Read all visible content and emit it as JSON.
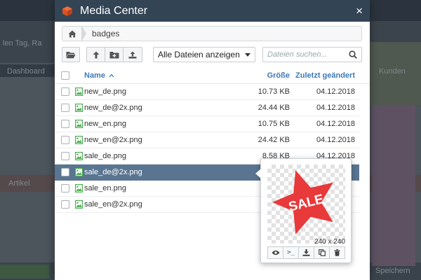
{
  "background": {
    "texts": [
      "len Tag, Ra",
      "Dashboard",
      "Artikel",
      "Kunden",
      "Speichern"
    ]
  },
  "modal": {
    "title": "Media Center",
    "close_label": "×"
  },
  "breadcrumb": {
    "current": "badges"
  },
  "toolbar": {
    "filter_selected": "Alle Dateien anzeigen",
    "search_placeholder": "Dateien suchen..."
  },
  "table": {
    "headers": {
      "name": "Name",
      "size": "Größe",
      "modified": "Zuletzt geändert"
    },
    "rows": [
      {
        "name": "new_de.png",
        "size": "10.73 KB",
        "date": "04.12.2018"
      },
      {
        "name": "new_de@2x.png",
        "size": "24.44 KB",
        "date": "04.12.2018"
      },
      {
        "name": "new_en.png",
        "size": "10.75 KB",
        "date": "04.12.2018"
      },
      {
        "name": "new_en@2x.png",
        "size": "24.42 KB",
        "date": "04.12.2018"
      },
      {
        "name": "sale_de.png",
        "size": "8.58 KB",
        "date": "04.12.2018"
      },
      {
        "name": "sale_de@2x.png",
        "size": "",
        "date": ""
      },
      {
        "name": "sale_en.png",
        "size": "",
        "date": ""
      },
      {
        "name": "sale_en@2x.png",
        "size": "",
        "date": ""
      }
    ],
    "selected_index": 5
  },
  "preview": {
    "badge_text": "SALE",
    "dimensions": "240 x 240",
    "star_color": "#e8393b"
  },
  "colors": {
    "header_bg": "#334455",
    "accent": "#3d7ab8",
    "selected_row": "#5a7591",
    "file_icon": "#4caf50"
  }
}
